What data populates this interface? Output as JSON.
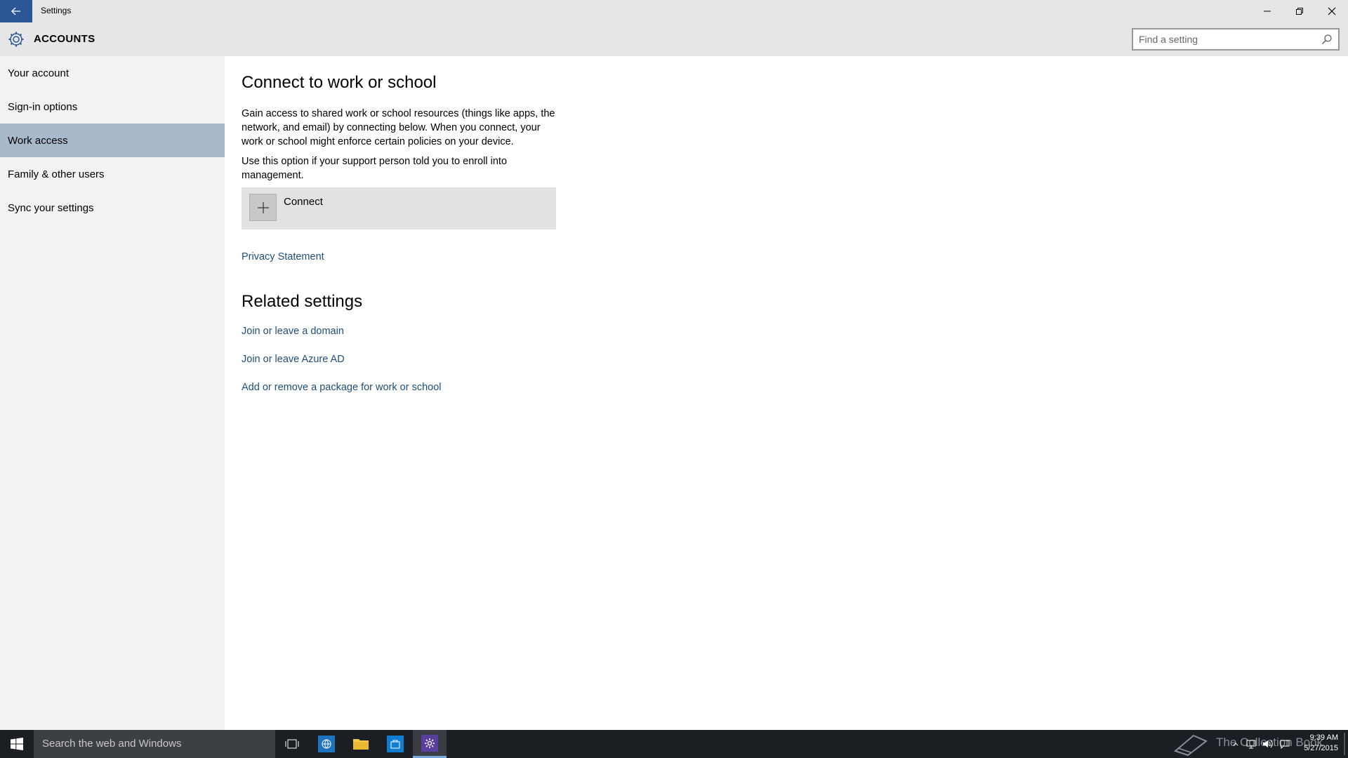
{
  "window": {
    "title": "Settings"
  },
  "header": {
    "section_title": "ACCOUNTS",
    "search_placeholder": "Find a setting"
  },
  "sidebar": {
    "items": [
      {
        "label": "Your account",
        "selected": false
      },
      {
        "label": "Sign-in options",
        "selected": false
      },
      {
        "label": "Work access",
        "selected": true
      },
      {
        "label": "Family & other users",
        "selected": false
      },
      {
        "label": "Sync your settings",
        "selected": false
      }
    ]
  },
  "main": {
    "title": "Connect to work or school",
    "description": "Gain access to shared work or school resources (things like apps, the network, and email) by connecting below. When you connect, your work or school might enforce certain policies on your device.",
    "enroll_note": "Use this option if your support person told you to enroll into management.",
    "connect_label": "Connect",
    "privacy_link": "Privacy Statement",
    "related_title": "Related settings",
    "related_links": [
      "Join or leave a domain",
      "Join or leave Azure AD",
      "Add or remove a package for work or school"
    ]
  },
  "taskbar": {
    "search_placeholder": "Search the web and Windows",
    "watermark": "The Collection Book",
    "time": "9:39 AM",
    "date": "5/27/2015"
  },
  "colors": {
    "accent": "#2b5797",
    "selected_nav": "#a8b9cc",
    "link": "#1e4e79",
    "taskbar": "#1b1f24"
  }
}
